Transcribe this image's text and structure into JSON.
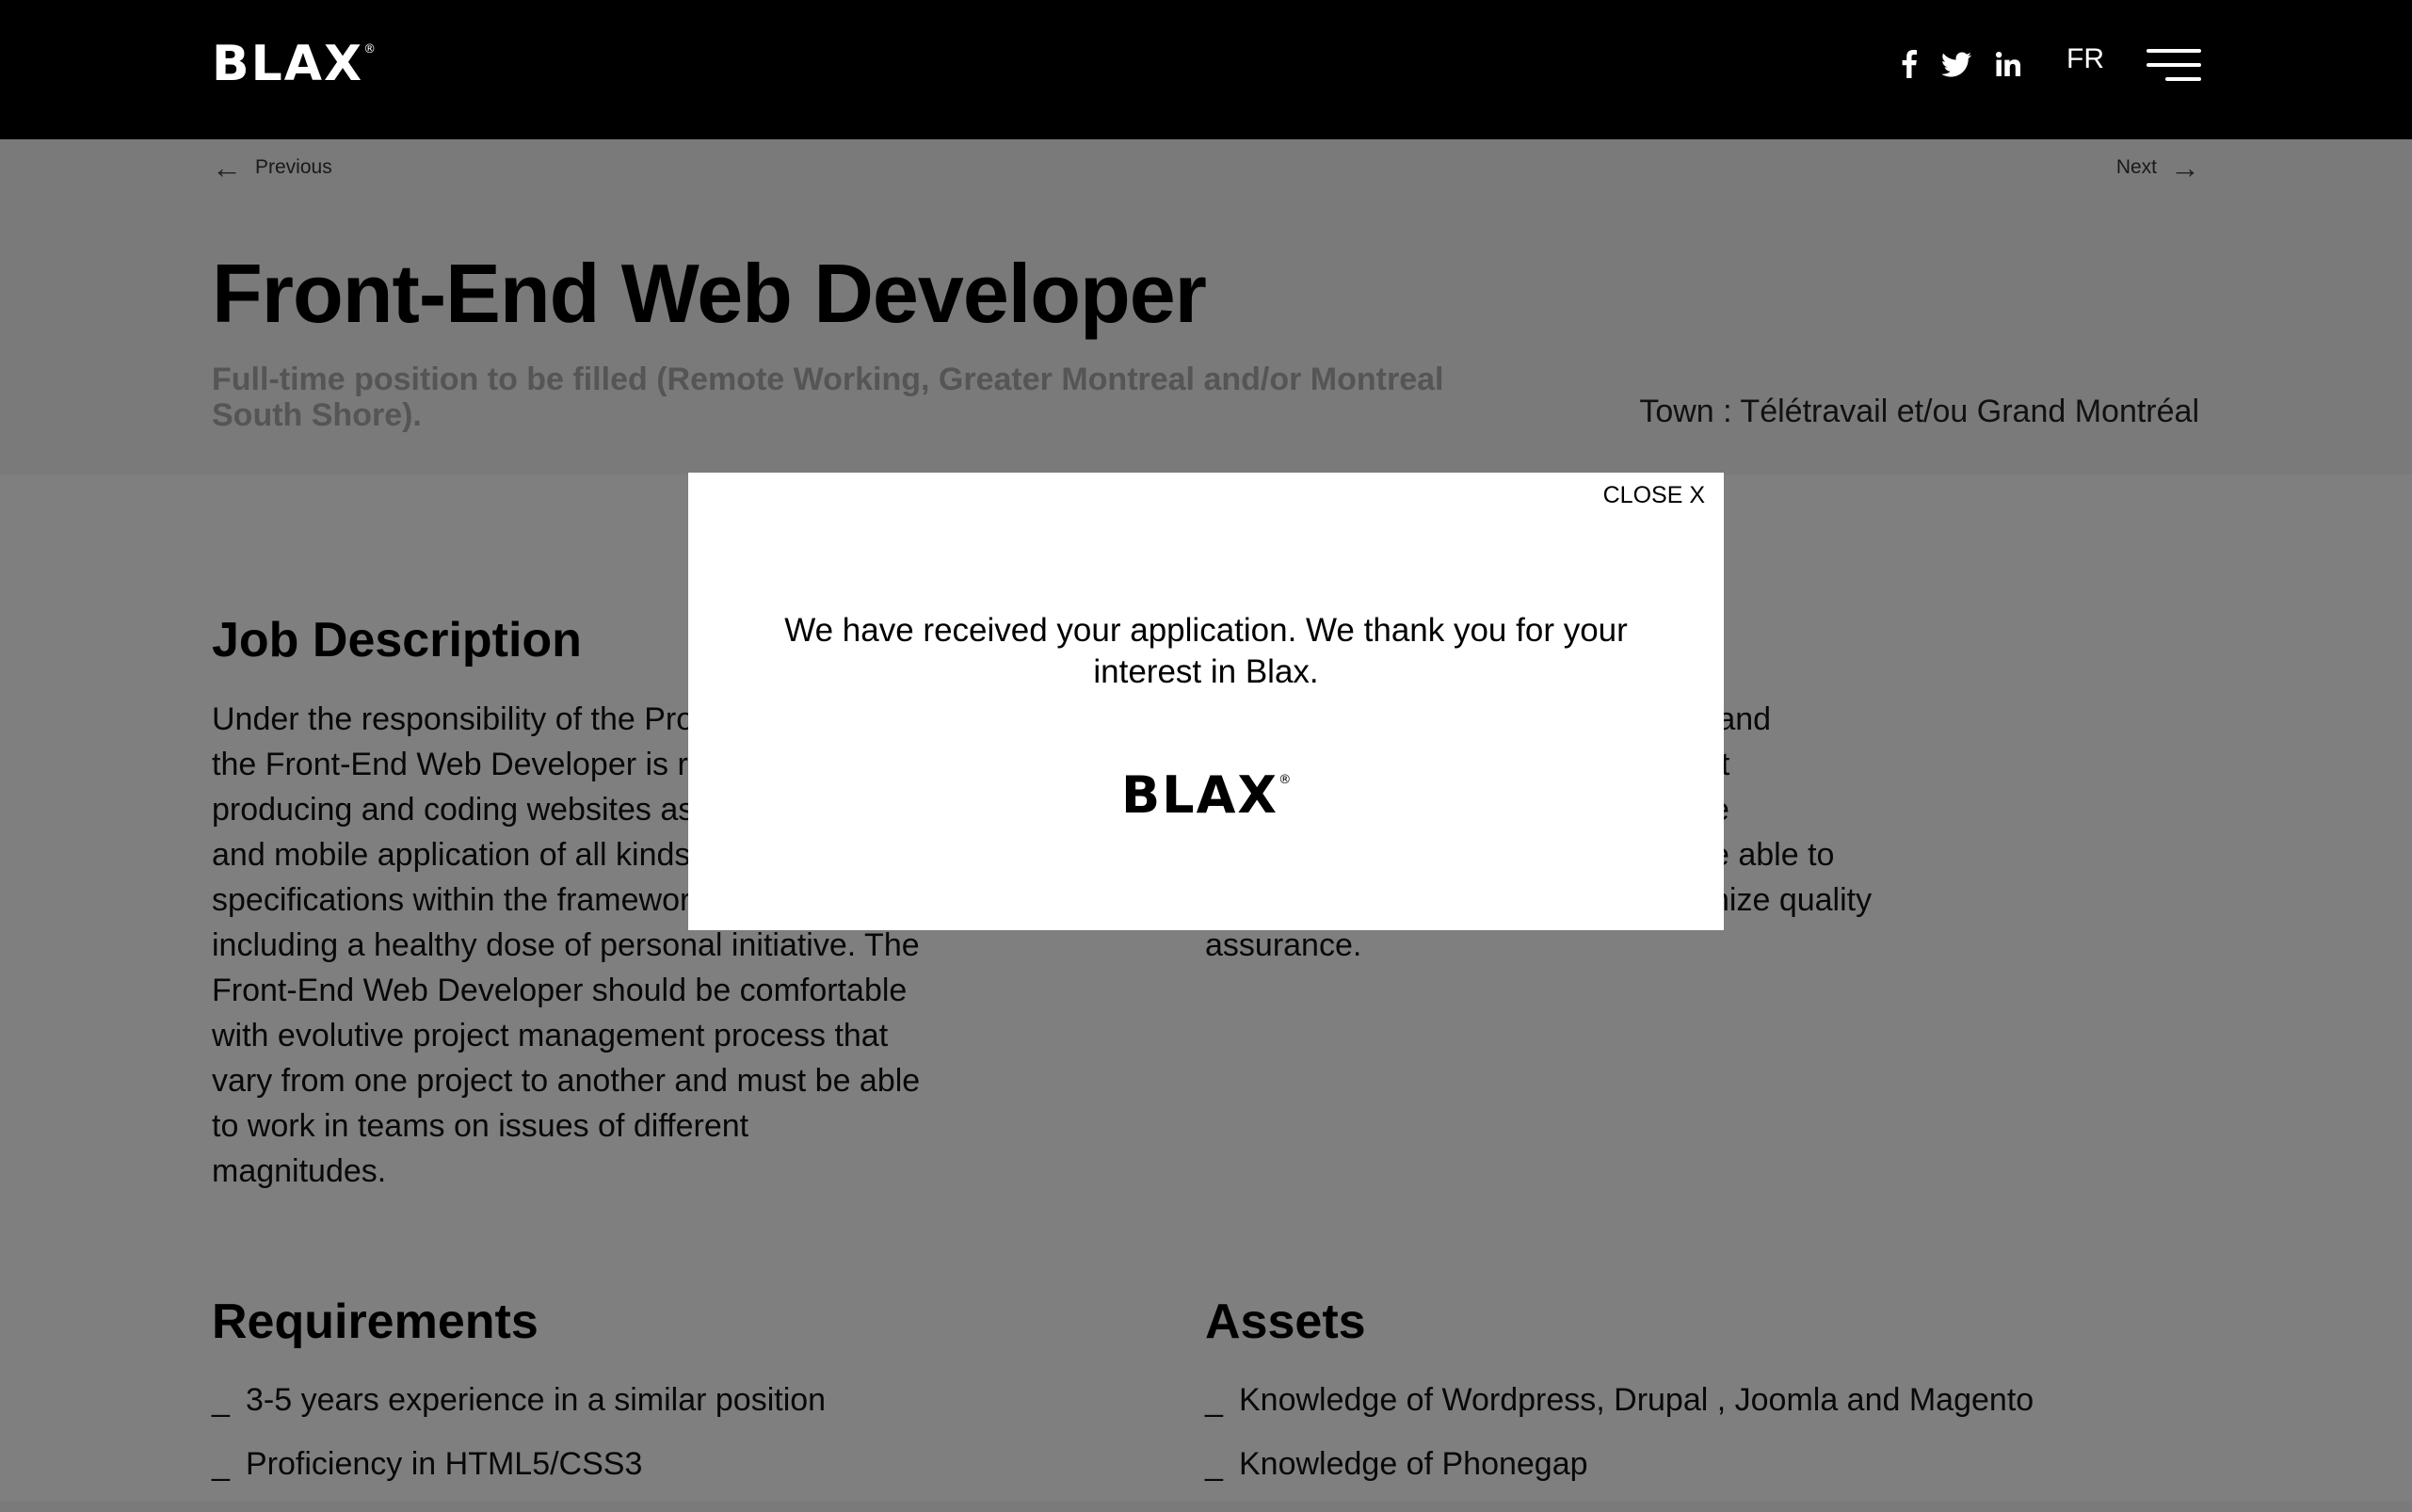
{
  "header": {
    "logo_text": "BLAX",
    "logo_mark": "®",
    "social": [
      {
        "icon": "facebook-icon"
      },
      {
        "icon": "twitter-icon"
      },
      {
        "icon": "linkedin-icon"
      }
    ],
    "lang_label": "FR",
    "menu_icon": "hamburger-menu-icon"
  },
  "nav": {
    "previous_label": "Previous",
    "next_label": "Next",
    "prev_arrow": "←",
    "next_arrow": "→"
  },
  "job": {
    "title": "Front-End Web Developer",
    "subtitle": "Full-time position to be filled (Remote Working, Greater Montreal and/or Montreal South Shore).",
    "town": "Town : Télétravail et/ou Grand Montréal"
  },
  "job_description": {
    "heading": "Job Description",
    "left_text": "Under the responsibility of the Project Manager, the Front-End Web Developer is responsible for producing and coding websites as well as web and mobile application of all kinds; Respect the specifications within the frameworks while including a healthy dose of personal initiative. The Front-End Web Developer should be comfortable with evolutive project management process that vary from one project to another and must be able to work in teams on issues of different magnitudes.",
    "right_lines": [
      "b and",
      "ect",
      "e",
      "e able to",
      "nize quality",
      "assurance."
    ]
  },
  "requirements": {
    "heading": "Requirements",
    "items": [
      "3-5 years experience in a similar position",
      "Proficiency in HTML5/CSS3"
    ]
  },
  "assets": {
    "heading": "Assets",
    "items": [
      "Knowledge of Wordpress, Drupal , Joomla and Magento",
      "Knowledge of Phonegap"
    ]
  },
  "modal": {
    "close_label": "CLOSE X",
    "message": "We have received your application. We thank you for your interest in Blax.",
    "logo_text": "BLAX",
    "logo_mark": "®"
  }
}
